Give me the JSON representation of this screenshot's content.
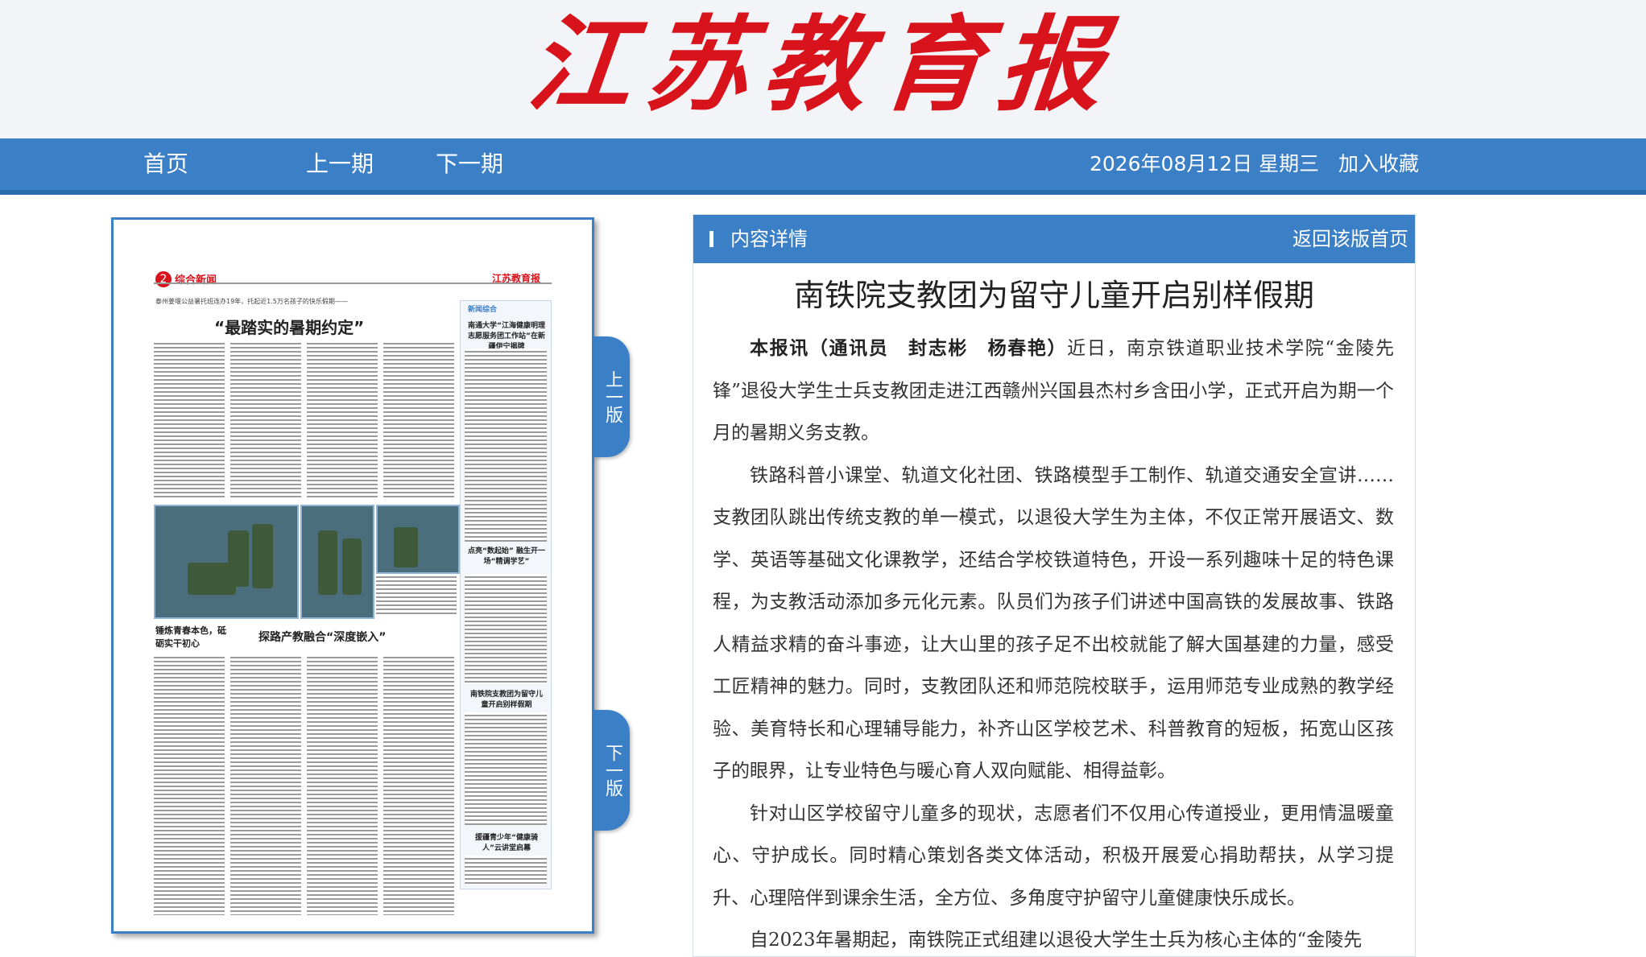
{
  "masthead": "江苏教育报",
  "nav": {
    "home": "首页",
    "prev_issue": "上一期",
    "next_issue": "下一期",
    "date": "2026年08月12日 星期三",
    "bookmark": "加入收藏"
  },
  "page_tabs": {
    "prev": "上一版",
    "next": "下一版"
  },
  "paper_page": {
    "page_number": "2",
    "section": "综合新闻",
    "mini_masthead": "江苏教育报",
    "headline_main": "“最踏实的暑期约定”",
    "headline_sub": "泰州姜堰公益暑托班连办19年，托起近1.5万名孩子的快乐假期——",
    "headline_2": "探路产教融合“深度嵌入”",
    "headline_3": "锤炼青春本色，砥砺实干初心",
    "sidebar_title": "新闻综合",
    "sidebar_items": [
      "南通大学“江海健康明理志愿服务团工作站”在新疆伊宁揭牌",
      "点亮“数起始” 融生开一场“精调学艺”",
      "南铁院支教团为留守儿童开启别样假期",
      "援疆青少年“健康骑人”云讲堂启幕"
    ]
  },
  "article": {
    "header_label": "内容详情",
    "back_link": "返回该版首页",
    "title": "南铁院支教团为留守儿童开启别样假期",
    "lead_bold": "本报讯（通讯员　封志彬　杨春艳）",
    "paragraphs": [
      "近日，南京铁道职业技术学院“金陵先锋”退役大学生士兵支教团走进江西赣州兴国县杰村乡含田小学，正式开启为期一个月的暑期义务支教。",
      "铁路科普小课堂、轨道文化社团、铁路模型手工制作、轨道交通安全宣讲……支教团队跳出传统支教的单一模式，以退役大学生为主体，不仅正常开展语文、数学、英语等基础文化课教学，还结合学校铁道特色，开设一系列趣味十足的特色课程，为支教活动添加多元化元素。队员们为孩子们讲述中国高铁的发展故事、铁路人精益求精的奋斗事迹，让大山里的孩子足不出校就能了解大国基建的力量，感受工匠精神的魅力。同时，支教团队还和师范院校联手，运用师范专业成熟的教学经验、美育特长和心理辅导能力，补齐山区学校艺术、科普教育的短板，拓宽山区孩子的眼界，让专业特色与暖心育人双向赋能、相得益彰。",
      "针对山区学校留守儿童多的现状，志愿者们不仅用心传道授业，更用情温暖童心、守护成长。同时精心策划各类文体活动，积极开展爱心捐助帮扶，从学习提升、心理陪伴到课余生活，全方位、多角度守护留守儿童健康快乐成长。",
      "自2023年暑期起，南铁院正式组建以退役大学生士兵为核心主体的“金陵先"
    ]
  }
}
